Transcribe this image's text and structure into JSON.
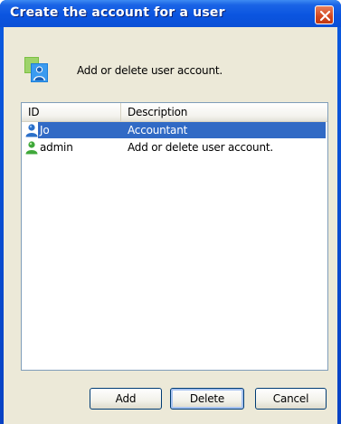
{
  "window": {
    "title": "Create the account for a user",
    "close_icon": "close-icon"
  },
  "header": {
    "icon": "user-account-icon",
    "text": "Add or delete user account."
  },
  "list": {
    "columns": [
      "ID",
      "Description"
    ],
    "rows": [
      {
        "id": "Jo",
        "description": "Accountant",
        "icon": "user-blue-icon",
        "selected": true
      },
      {
        "id": "admin",
        "description": "Add or delete user account.",
        "icon": "user-green-icon",
        "selected": false
      }
    ]
  },
  "buttons": {
    "add": "Add",
    "delete": "Delete",
    "cancel": "Cancel"
  },
  "colors": {
    "titlebar": "#0b55e0",
    "selection": "#316ac5",
    "dialog_bg": "#ece9d8",
    "close_button": "#d2461e"
  }
}
